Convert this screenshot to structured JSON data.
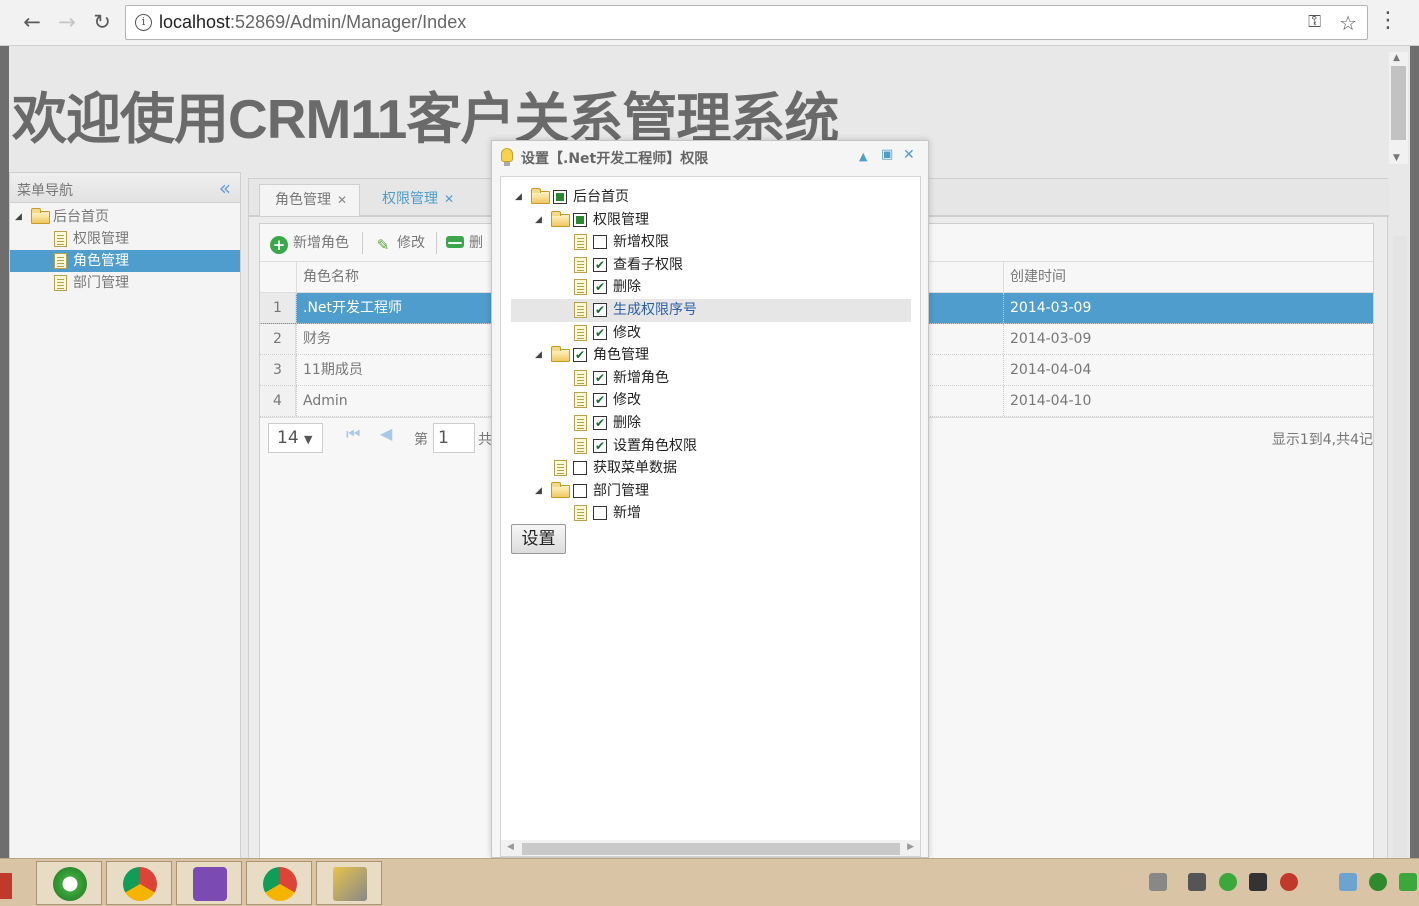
{
  "browser": {
    "url_host": "localhost",
    "url_path": ":52869/Admin/Manager/Index"
  },
  "page": {
    "title": "欢迎使用CRM11客户关系管理系统"
  },
  "west": {
    "header": "菜单导航",
    "items": [
      {
        "label": "后台首页"
      },
      {
        "label": "权限管理"
      },
      {
        "label": "角色管理"
      },
      {
        "label": "部门管理"
      }
    ]
  },
  "tabs": [
    {
      "label": "角色管理"
    },
    {
      "label": "权限管理"
    }
  ],
  "grid": {
    "toolbar": {
      "add": "新增角色",
      "edit": "修改",
      "delete": "删"
    },
    "columns": {
      "name": "角色名称",
      "created": "创建时间"
    },
    "rows": [
      {
        "num": "1",
        "name": ".Net开发工程师",
        "created": "2014-03-09"
      },
      {
        "num": "2",
        "name": "财务",
        "created": "2014-03-09"
      },
      {
        "num": "3",
        "name": "11期成员",
        "created": "2014-04-04"
      },
      {
        "num": "4",
        "name": "Admin",
        "created": "2014-04-10"
      }
    ],
    "pager": {
      "page_size": "14",
      "page_word": "第",
      "page_num": "1",
      "page_suffix": "共",
      "info": "显示1到4,共4记"
    }
  },
  "dialog": {
    "title": "设置【.Net开发工程师】权限",
    "tree": [
      {
        "label": "后台首页"
      },
      {
        "label": "权限管理"
      },
      {
        "label": "新增权限"
      },
      {
        "label": "查看子权限"
      },
      {
        "label": "删除"
      },
      {
        "label": "生成权限序号"
      },
      {
        "label": "修改"
      },
      {
        "label": "角色管理"
      },
      {
        "label": "新增角色"
      },
      {
        "label": "修改"
      },
      {
        "label": "删除"
      },
      {
        "label": "设置角色权限"
      },
      {
        "label": "获取菜单数据"
      },
      {
        "label": "部门管理"
      },
      {
        "label": "新增"
      }
    ],
    "submit": "设置"
  }
}
